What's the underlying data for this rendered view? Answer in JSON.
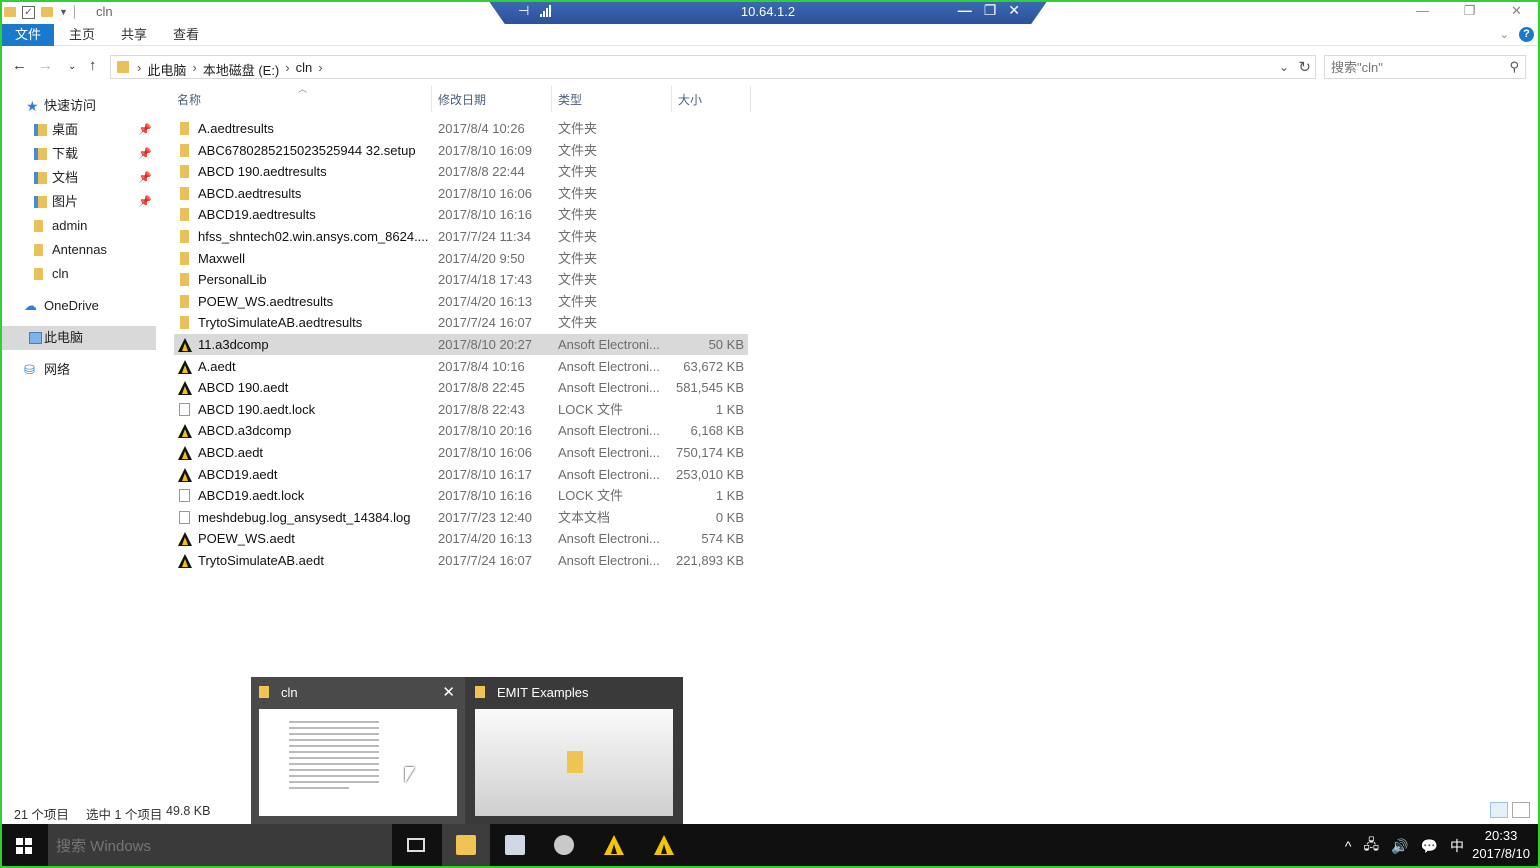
{
  "window": {
    "title": "cln",
    "controls": [
      "—",
      "❐",
      "✕"
    ]
  },
  "remote_bar": {
    "host": "10.64.1.2",
    "pin": "⊣",
    "minimize": "—",
    "restore": "❐",
    "close": "✕"
  },
  "ribbon": {
    "tabs": [
      "文件",
      "主页",
      "共享",
      "查看"
    ],
    "help": "?"
  },
  "address": {
    "crumbs": [
      "此电脑",
      "本地磁盘 (E:)",
      "cln"
    ]
  },
  "search": {
    "placeholder": "搜索\"cln\""
  },
  "sidebar": {
    "items": [
      {
        "label": "快速访问"
      },
      {
        "label": "桌面",
        "pinned": true
      },
      {
        "label": "下载",
        "pinned": true
      },
      {
        "label": "文档",
        "pinned": true
      },
      {
        "label": "图片",
        "pinned": true
      },
      {
        "label": "admin"
      },
      {
        "label": "Antennas"
      },
      {
        "label": "cln"
      },
      {
        "label": "OneDrive"
      },
      {
        "label": "此电脑"
      },
      {
        "label": "网络"
      }
    ]
  },
  "columns": [
    "名称",
    "修改日期",
    "类型",
    "大小"
  ],
  "files": [
    {
      "name": "A.aedtresults",
      "date": "2017/8/4 10:26",
      "type": "文件夹",
      "size": "",
      "icon": "folder"
    },
    {
      "name": "ABC6780285215023525944 32.setup",
      "date": "2017/8/10 16:09",
      "type": "文件夹",
      "size": "",
      "icon": "folder"
    },
    {
      "name": "ABCD 190.aedtresults",
      "date": "2017/8/8 22:44",
      "type": "文件夹",
      "size": "",
      "icon": "folder"
    },
    {
      "name": "ABCD.aedtresults",
      "date": "2017/8/10 16:06",
      "type": "文件夹",
      "size": "",
      "icon": "folder"
    },
    {
      "name": "ABCD19.aedtresults",
      "date": "2017/8/10 16:16",
      "type": "文件夹",
      "size": "",
      "icon": "folder"
    },
    {
      "name": "hfss_shntech02.win.ansys.com_8624....",
      "date": "2017/7/24 11:34",
      "type": "文件夹",
      "size": "",
      "icon": "folder"
    },
    {
      "name": "Maxwell",
      "date": "2017/4/20 9:50",
      "type": "文件夹",
      "size": "",
      "icon": "folder"
    },
    {
      "name": "PersonalLib",
      "date": "2017/4/18 17:43",
      "type": "文件夹",
      "size": "",
      "icon": "folder"
    },
    {
      "name": "POEW_WS.aedtresults",
      "date": "2017/4/20 16:13",
      "type": "文件夹",
      "size": "",
      "icon": "folder"
    },
    {
      "name": "TrytoSimulateAB.aedtresults",
      "date": "2017/7/24 16:07",
      "type": "文件夹",
      "size": "",
      "icon": "folder"
    },
    {
      "name": "11.a3dcomp",
      "date": "2017/8/10 20:27",
      "type": "Ansoft Electroni...",
      "size": "50 KB",
      "icon": "ansys",
      "selected": true
    },
    {
      "name": "A.aedt",
      "date": "2017/8/4 10:16",
      "type": "Ansoft Electroni...",
      "size": "63,672 KB",
      "icon": "ansys"
    },
    {
      "name": "ABCD 190.aedt",
      "date": "2017/8/8 22:45",
      "type": "Ansoft Electroni...",
      "size": "581,545 KB",
      "icon": "ansys"
    },
    {
      "name": "ABCD 190.aedt.lock",
      "date": "2017/8/8 22:43",
      "type": "LOCK 文件",
      "size": "1 KB",
      "icon": "file"
    },
    {
      "name": "ABCD.a3dcomp",
      "date": "2017/8/10 20:16",
      "type": "Ansoft Electroni...",
      "size": "6,168 KB",
      "icon": "ansys"
    },
    {
      "name": "ABCD.aedt",
      "date": "2017/8/10 16:06",
      "type": "Ansoft Electroni...",
      "size": "750,174 KB",
      "icon": "ansys"
    },
    {
      "name": "ABCD19.aedt",
      "date": "2017/8/10 16:17",
      "type": "Ansoft Electroni...",
      "size": "253,010 KB",
      "icon": "ansys"
    },
    {
      "name": "ABCD19.aedt.lock",
      "date": "2017/8/10 16:16",
      "type": "LOCK 文件",
      "size": "1 KB",
      "icon": "file"
    },
    {
      "name": "meshdebug.log_ansysedt_14384.log",
      "date": "2017/7/23 12:40",
      "type": "文本文档",
      "size": "0 KB",
      "icon": "text"
    },
    {
      "name": "POEW_WS.aedt",
      "date": "2017/4/20 16:13",
      "type": "Ansoft Electroni...",
      "size": "574 KB",
      "icon": "ansys"
    },
    {
      "name": "TrytoSimulateAB.aedt",
      "date": "2017/7/24 16:07",
      "type": "Ansoft Electroni...",
      "size": "221,893 KB",
      "icon": "ansys"
    }
  ],
  "status": {
    "count": "21 个项目",
    "selected": "选中 1 个项目",
    "selected_size": "49.8 KB"
  },
  "thumbnails": [
    {
      "title": "cln",
      "close": "✕"
    },
    {
      "title": "EMIT Examples"
    }
  ],
  "taskbar": {
    "search_placeholder": "搜索 Windows",
    "tray": [
      "^",
      "🖧",
      "🔊",
      "💬",
      "中"
    ],
    "time": "20:33",
    "date": "2017/8/10"
  },
  "colors": {
    "accent": "#1979ca",
    "frame": "#2fd02f",
    "selection": "#d9d9d9"
  }
}
